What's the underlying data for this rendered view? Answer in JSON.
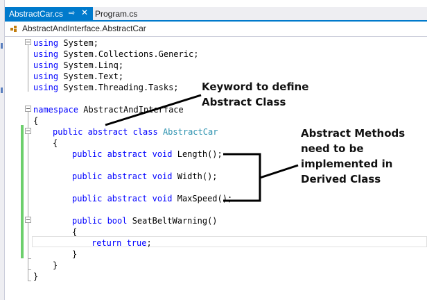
{
  "tabs": [
    {
      "label": "AbstractCar.cs",
      "pin": "⇨",
      "close": "✕"
    },
    {
      "label": "Program.cs"
    }
  ],
  "nav": {
    "class_path": "AbstractAndInterface.AbstractCar"
  },
  "code": {
    "using": [
      {
        "kw": "using",
        "ns": " System;"
      },
      {
        "kw": "using",
        "ns": " System.Collections.Generic;"
      },
      {
        "kw": "using",
        "ns": " System.Linq;"
      },
      {
        "kw": "using",
        "ns": " System.Text;"
      },
      {
        "kw": "using",
        "ns": " System.Threading.Tasks;"
      }
    ],
    "namespace_kw": "namespace",
    "namespace_name": " AbstractAndInterface",
    "brace_open": "{",
    "class_decl": {
      "kw": "public abstract class ",
      "name": "AbstractCar"
    },
    "class_brace_open": "{",
    "methods": [
      {
        "kw": "public abstract void ",
        "sig": "Length();"
      },
      {
        "kw": "public abstract void ",
        "sig": "Width();"
      },
      {
        "kw": "public abstract void ",
        "sig": "MaxSpeed();"
      }
    ],
    "seatbelt": {
      "kw": "public bool ",
      "sig": "SeatBeltWarning()"
    },
    "method_brace_open": "{",
    "return_stmt": {
      "kw": "return true",
      "rest": ";"
    },
    "method_brace_close": "}",
    "class_brace_close": "}",
    "brace_close": "}"
  },
  "annotations": {
    "keyword_note": "Keyword to define\nAbstract Class",
    "methods_note": "Abstract Methods\nneed to be\nimplemented in\nDerived Class"
  },
  "colors": {
    "keyword": "#0000ff",
    "type": "#2b91af",
    "accent": "#007acc",
    "changed": "#6ccf6c"
  }
}
